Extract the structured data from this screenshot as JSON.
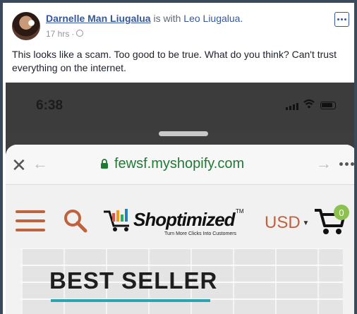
{
  "post": {
    "author": "Darnelle Man Liugalua",
    "with_text": "is with",
    "tagged": "Leo Liugalua.",
    "time": "17 hrs",
    "separator": "·",
    "text": "This looks like a scam. Too good to be true. What do you think? Can't trust everything on the internet."
  },
  "screenshot": {
    "phone_time": "6:38",
    "url": "fewsf.myshopify.com",
    "shop": {
      "logo_text": "Shoptimized",
      "logo_tm": "TM",
      "tagline": "Turn More Clicks Into Customers",
      "currency": "USD",
      "cart_count": "0",
      "banner_title": "BEST SELLER"
    }
  },
  "icons": {
    "more": "more-options-icon",
    "globe": "globe-icon",
    "close": "close-icon",
    "back": "back-arrow-icon",
    "forward": "forward-arrow-icon",
    "lock": "lock-icon",
    "menu": "hamburger-menu-icon",
    "search": "search-icon",
    "cart": "cart-icon"
  },
  "colors": {
    "link": "#365899",
    "shop_accent": "#c0623e",
    "url_green": "#1f7a34",
    "badge_green": "#8cc152",
    "banner_underline": "#2aa6b2"
  }
}
